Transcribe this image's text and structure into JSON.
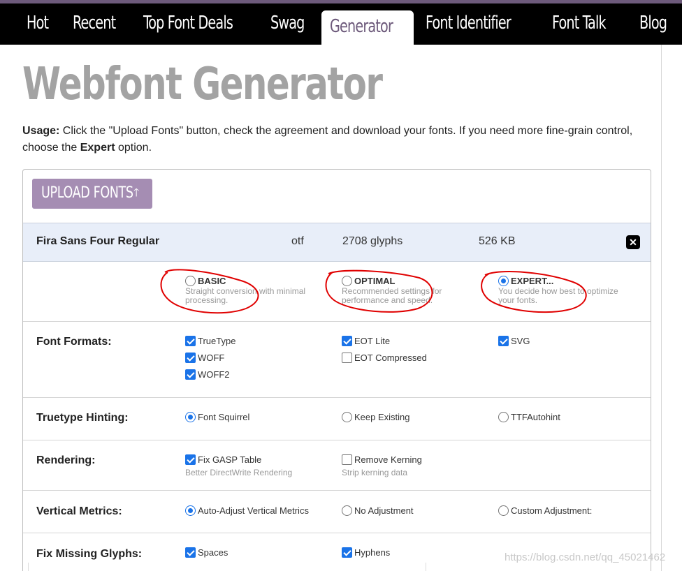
{
  "nav": {
    "items": [
      {
        "label": "Hot",
        "id": "hot"
      },
      {
        "label": "Recent",
        "id": "recent"
      },
      {
        "label": "Top Font Deals",
        "id": "top-font-deals"
      },
      {
        "label": "Swag",
        "id": "swag"
      },
      {
        "label": "Generator",
        "id": "generator",
        "active": true
      },
      {
        "label": "Font Identifier",
        "id": "font-identifier"
      },
      {
        "label": "Font Talk",
        "id": "font-talk"
      },
      {
        "label": "Blog",
        "id": "blog"
      }
    ]
  },
  "page": {
    "title": "Webfont Generator",
    "usage_label": "Usage:",
    "usage_text_1": " Click the \"Upload Fonts\" button, check the agreement and download your fonts. If you need more fine-grain control, choose the ",
    "usage_bold": "Expert",
    "usage_text_2": " option."
  },
  "upload": {
    "label": "UPLOAD FONTS",
    "icon": "arrow-up-icon",
    "arrow_glyph": "🡑"
  },
  "file": {
    "name": "Fira Sans Four Regular",
    "ext": "otf",
    "glyphs": "2708 glyphs",
    "size": "526 KB",
    "remove_glyph": "✕"
  },
  "modes": [
    {
      "label": "BASIC",
      "desc": "Straight conversion with minimal processing.",
      "selected": false
    },
    {
      "label": "OPTIMAL",
      "desc": "Recommended settings for performance and speed.",
      "selected": false
    },
    {
      "label": "EXPERT...",
      "desc": "You decide how best to optimize your fonts.",
      "selected": true
    }
  ],
  "font_formats": {
    "label": "Font Formats:",
    "options": [
      {
        "label": "TrueType",
        "checked": true
      },
      {
        "label": "WOFF",
        "checked": true
      },
      {
        "label": "WOFF2",
        "checked": true
      },
      {
        "label": "EOT Lite",
        "checked": true
      },
      {
        "label": "EOT Compressed",
        "checked": false
      },
      {
        "label": "SVG",
        "checked": true
      }
    ]
  },
  "hinting": {
    "label": "Truetype Hinting:",
    "options": [
      {
        "label": "Font Squirrel",
        "selected": true
      },
      {
        "label": "Keep Existing",
        "selected": false
      },
      {
        "label": "TTFAutohint",
        "selected": false
      }
    ]
  },
  "rendering": {
    "label": "Rendering:",
    "options": [
      {
        "label": "Fix GASP Table",
        "desc": "Better DirectWrite Rendering",
        "checked": true
      },
      {
        "label": "Remove Kerning",
        "desc": "Strip kerning data",
        "checked": false
      }
    ]
  },
  "vertical_metrics": {
    "label": "Vertical Metrics:",
    "options": [
      {
        "label": "Auto-Adjust Vertical Metrics",
        "selected": true
      },
      {
        "label": "No Adjustment",
        "selected": false
      },
      {
        "label": "Custom Adjustment:",
        "selected": false
      }
    ]
  },
  "missing_glyphs": {
    "label": "Fix Missing Glyphs:",
    "options": [
      {
        "label": "Spaces",
        "checked": true
      },
      {
        "label": "Hyphens",
        "checked": true
      }
    ]
  },
  "watermark": "https://blog.csdn.net/qq_45021462",
  "colors": {
    "accent": "#a58db3",
    "nav_active_text": "#6d5a7b",
    "control_blue": "#1a73e8",
    "annotation_red": "#e00000"
  }
}
